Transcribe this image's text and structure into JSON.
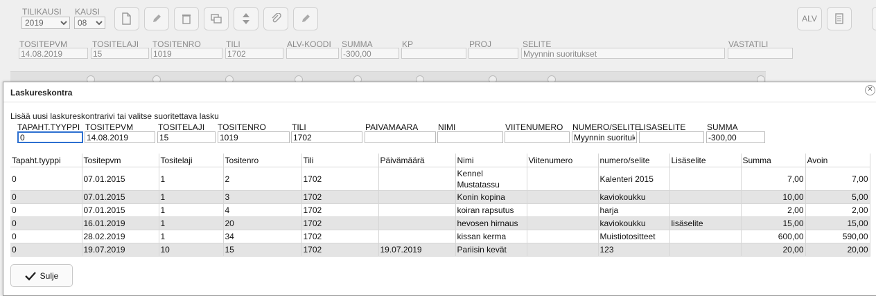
{
  "background": {
    "period": {
      "tilikausi_label": "TILIKAUSI",
      "tilikausi_value": "2019",
      "kausi_label": "KAUSI",
      "kausi_value": "08"
    },
    "toolbar": {
      "alv_label": "ALV"
    },
    "fields": [
      {
        "label": "TOSITEPVM",
        "value": "14.08.2019"
      },
      {
        "label": "TOSITELAJI",
        "value": "15"
      },
      {
        "label": "TOSITENRO",
        "value": "1019"
      },
      {
        "label": "TILI",
        "value": "1702"
      },
      {
        "label": "ALV-KOODI",
        "value": ""
      },
      {
        "label": "SUMMA",
        "value": "-300,00"
      },
      {
        "label": "KP",
        "value": ""
      },
      {
        "label": "PROJ",
        "value": ""
      },
      {
        "label": "SELITE",
        "value": "Myynnin suoritukset"
      },
      {
        "label": "VASTATILI",
        "value": ""
      }
    ]
  },
  "dialog": {
    "title": "Laskureskontra",
    "hint": "Lisää uusi laskureskontrarivi tai valitse suoritettava lasku",
    "form": [
      {
        "label": "TAPAHT.TYYPPI",
        "value": "0"
      },
      {
        "label": "TOSITEPVM",
        "value": "14.08.2019"
      },
      {
        "label": "TOSITELAJI",
        "value": "15"
      },
      {
        "label": "TOSITENRO",
        "value": "1019"
      },
      {
        "label": "TILI",
        "value": "1702"
      },
      {
        "label": "PAIVAMAARA",
        "value": ""
      },
      {
        "label": "NIMI",
        "value": ""
      },
      {
        "label": "VIITENUMERO",
        "value": ""
      },
      {
        "label": "NUMERO/SELITE",
        "value": "Myynnin suoritukset"
      },
      {
        "label": "LISASELITE",
        "value": ""
      },
      {
        "label": "SUMMA",
        "value": "-300,00"
      }
    ],
    "columns": [
      "Tapaht.tyyppi",
      "Tositepvm",
      "Tositelaji",
      "Tositenro",
      "Tili",
      "Päivämäärä",
      "Nimi",
      "Viitenumero",
      "numero/selite",
      "Lisäselite",
      "Summa",
      "Avoin"
    ],
    "rows": [
      [
        "0",
        "07.01.2015",
        "1",
        "2",
        "1702",
        "",
        "Kennel Mustatassu",
        "",
        "Kalenteri 2015",
        "",
        "7,00",
        "7,00"
      ],
      [
        "0",
        "07.01.2015",
        "1",
        "3",
        "1702",
        "",
        "Konin kopina",
        "",
        "kaviokoukku",
        "",
        "10,00",
        "5,00"
      ],
      [
        "0",
        "07.01.2015",
        "1",
        "4",
        "1702",
        "",
        "koiran rapsutus",
        "",
        "harja",
        "",
        "2,00",
        "2,00"
      ],
      [
        "0",
        "16.01.2019",
        "1",
        "20",
        "1702",
        "",
        "hevosen hirnaus",
        "",
        "kaviokoukku",
        "lisäselite",
        "15,00",
        "15,00"
      ],
      [
        "0",
        "28.02.2019",
        "1",
        "34",
        "1702",
        "",
        "kissan kerma",
        "",
        "Muistiotositteet",
        "",
        "600,00",
        "590,00"
      ],
      [
        "0",
        "19.07.2019",
        "10",
        "15",
        "1702",
        "19.07.2019",
        "Pariisin kevät",
        "",
        "123",
        "",
        "20,00",
        "20,00"
      ]
    ],
    "close_label": "Sulje"
  }
}
